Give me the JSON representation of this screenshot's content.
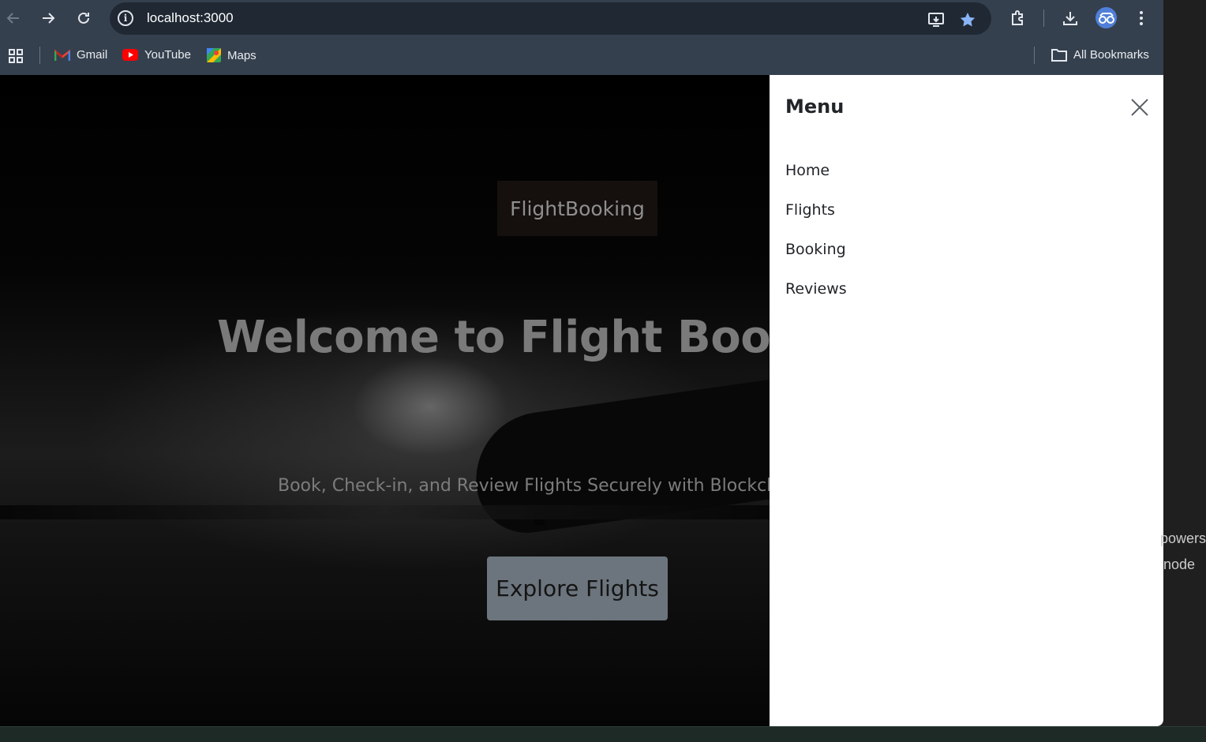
{
  "browser": {
    "url": "localhost:3000",
    "bookmarks": [
      {
        "label": "Gmail",
        "icon": "gmail-icon"
      },
      {
        "label": "YouTube",
        "icon": "youtube-icon"
      },
      {
        "label": "Maps",
        "icon": "maps-icon"
      }
    ],
    "all_bookmarks_label": "All Bookmarks"
  },
  "page": {
    "brand": "FlightBooking",
    "hero_title": "Welcome to Flight Booking",
    "hero_subtitle": "Book, Check-in, and Review Flights Securely with Blockchain",
    "cta_label": "Explore Flights"
  },
  "menu": {
    "title": "Menu",
    "items": [
      "Home",
      "Flights",
      "Booking",
      "Reviews"
    ]
  },
  "editor": {
    "line1": "powers",
    "line2": "node"
  },
  "colors": {
    "toolbar": "#35404e",
    "cta": "#6c757d",
    "accent": "#4f7fd9"
  }
}
